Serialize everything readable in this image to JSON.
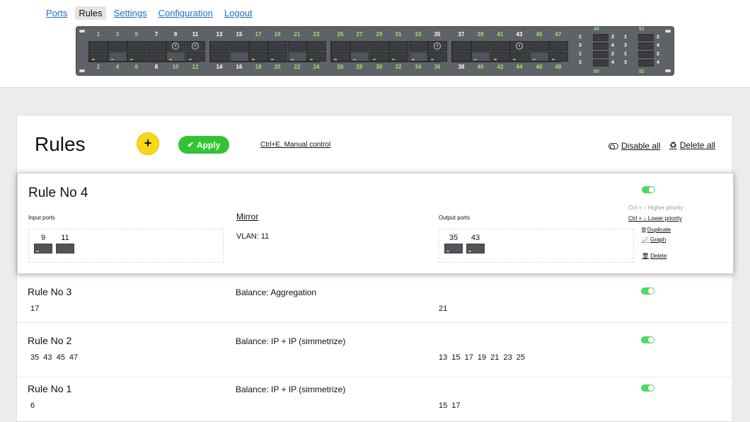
{
  "nav": [
    "Ports",
    "Rules",
    "Settings",
    "Configuration",
    "Logout"
  ],
  "active_nav": "Rules",
  "panel": {
    "top_ports": [
      "1",
      "3",
      "5",
      "7",
      "9",
      "11",
      "13",
      "15",
      "17",
      "19",
      "21",
      "23",
      "25",
      "27",
      "29",
      "31",
      "33",
      "35",
      "37",
      "39",
      "41",
      "43",
      "45",
      "47"
    ],
    "bottom_ports": [
      "2",
      "4",
      "6",
      "8",
      "10",
      "12",
      "14",
      "16",
      "18",
      "20",
      "22",
      "24",
      "26",
      "28",
      "30",
      "32",
      "34",
      "36",
      "38",
      "40",
      "42",
      "44",
      "46",
      "48"
    ],
    "sfp_modules": [
      "49",
      "50",
      "51",
      "52"
    ],
    "sfp_lane_labels": [
      "1",
      "2",
      "3",
      "4"
    ]
  },
  "page_title": "Rules",
  "add_label": "+",
  "apply_label": "Apply",
  "manual_control": "Ctrl+E. Manual control",
  "disable_all": "Disable all",
  "delete_all": "Delete all",
  "selected_rule": {
    "title": "Rule No 4",
    "input_label": "Input ports",
    "input_ports": [
      "9",
      "11"
    ],
    "mode_link": "Mirror",
    "vlan": "VLAN: 11",
    "output_label": "Output ports",
    "output_ports": [
      "35",
      "43"
    ],
    "enabled": true,
    "higher_priority": "Ctrl + ↑ Higher priority",
    "lower_priority": "Ctrl + ↓ Lower priority",
    "duplicate": "Duplicate",
    "graph": "Graph",
    "delete": "Delete"
  },
  "rules": [
    {
      "title": "Rule No 3",
      "mode": "Balance: Aggregation",
      "inputs": "17",
      "outputs": "21",
      "enabled": true
    },
    {
      "title": "Rule No 2",
      "mode": "Balance: IP + IP (simmetrize)",
      "inputs": "35 43 45 47",
      "outputs": "13 15 17 19 21 23 25",
      "enabled": true
    },
    {
      "title": "Rule No 1",
      "mode": "Balance: IP + IP (simmetrize)",
      "inputs": "6",
      "outputs": "15 17",
      "enabled": true
    }
  ],
  "colors": {
    "link": "#1d6fc8",
    "apply": "#33c433",
    "add": "#f9d71c",
    "toggle_on": "#4cd964",
    "panel": "#5f6267",
    "led_orange": "#f39c12",
    "led_green": "#4cd137"
  },
  "icons": {
    "apply": "check-icon",
    "disable_all": "toggle-off-icon",
    "delete_all": "recycle-icon",
    "duplicate": "copy-icon",
    "graph": "chart-icon",
    "delete": "trash-icon"
  }
}
